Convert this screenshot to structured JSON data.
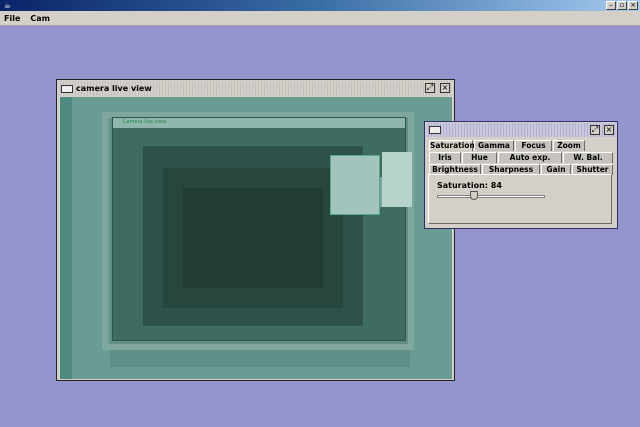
{
  "app": {
    "menu": [
      "File",
      "Cam"
    ]
  },
  "camera_window": {
    "title": "camera live view",
    "preview_title": "Camera live view"
  },
  "control_window": {
    "tabs_row1": [
      "Saturation",
      "Gamma",
      "Focus",
      "Zoom"
    ],
    "tabs_row2": [
      "Iris",
      "Hue",
      "Auto exp.",
      "W. Bal."
    ],
    "tabs_row3": [
      "Brightness",
      "Sharpness",
      "Gain",
      "Shutter"
    ],
    "selected_tab": "Saturation",
    "saturation_label": "Saturation: 84",
    "saturation_fraction": 0.33
  }
}
